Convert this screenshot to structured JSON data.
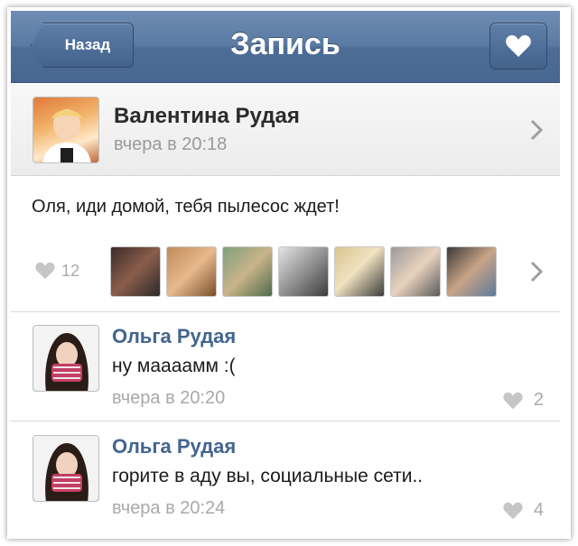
{
  "navbar": {
    "back_label": "Назад",
    "title": "Запись",
    "heart_icon": "heart-icon"
  },
  "post": {
    "author": "Валентина Рудая",
    "time": "вчера в 20:18",
    "text": "Оля, иди домой, тебя пылесос ждет!",
    "likes": "12",
    "liker_avatars": [
      "avatar-1",
      "avatar-2",
      "avatar-3",
      "avatar-4",
      "avatar-5",
      "avatar-6",
      "avatar-7"
    ]
  },
  "comments": [
    {
      "author": "Ольга Рудая",
      "text": "ну маааамм :(",
      "time": "вчера в 20:20",
      "likes": "2"
    },
    {
      "author": "Ольга Рудая",
      "text": "горите в аду вы, социальные сети..",
      "time": "вчера в 20:24",
      "likes": "4"
    }
  ],
  "colors": {
    "nav_blue": "#5a7aa3",
    "link_blue": "#43658e",
    "muted_gray": "#a9a9a9"
  }
}
